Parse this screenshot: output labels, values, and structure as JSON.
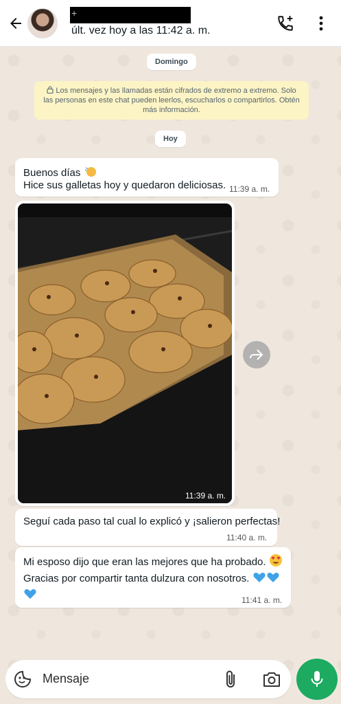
{
  "header": {
    "name_prefix": "+",
    "status": "últ. vez hoy a las 11:42 a. m."
  },
  "chips": {
    "day1": "Domingo",
    "day2": "Hoy"
  },
  "notice": {
    "text": "Los mensajes y las llamadas están cifrados de extremo a extremo. Solo las personas en este chat pueden leerlos, escucharlos o compartirlos. Obtén más información."
  },
  "messages": [
    {
      "line1": "Buenos días",
      "line2": "Hice sus galletas hoy y quedaron deliciosas.",
      "time": "11:39 a. m."
    },
    {
      "type": "image",
      "time": "11:39 a. m."
    },
    {
      "line1": "Seguí cada paso tal cual lo explicó y ¡salieron perfectas!",
      "time": "11:40 a. m."
    },
    {
      "line1": "Mi esposo dijo que eran las mejores que ha probado.",
      "line2": "Gracias por compartir tanta dulzura con nosotros.",
      "time": "11:41 a. m."
    }
  ],
  "input": {
    "placeholder": "Mensaje"
  },
  "colors": {
    "accent": "#1daa61",
    "notice_bg": "#fdf4c5",
    "chat_bg": "#efe7de"
  }
}
